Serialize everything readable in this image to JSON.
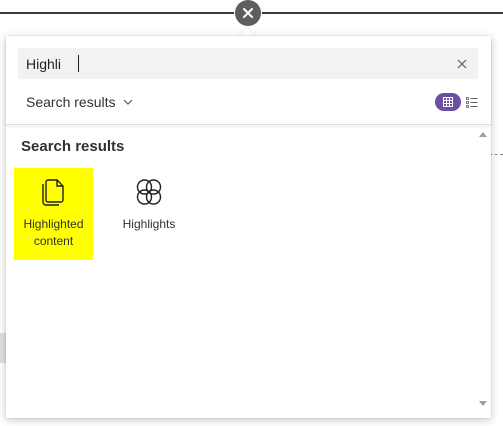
{
  "search": {
    "value": "Highli",
    "placeholder": ""
  },
  "filter": {
    "label": "Search results"
  },
  "results": {
    "title": "Search results",
    "items": [
      {
        "label": "Highlighted content",
        "icon": "document-stack-icon",
        "highlighted": true
      },
      {
        "label": "Highlights",
        "icon": "highlights-petals-icon",
        "highlighted": false
      }
    ]
  },
  "colors": {
    "accent": "#6b4fa0",
    "highlight": "#ffff00",
    "close_bg": "#605e5c",
    "search_bg": "#f3f2f1"
  }
}
